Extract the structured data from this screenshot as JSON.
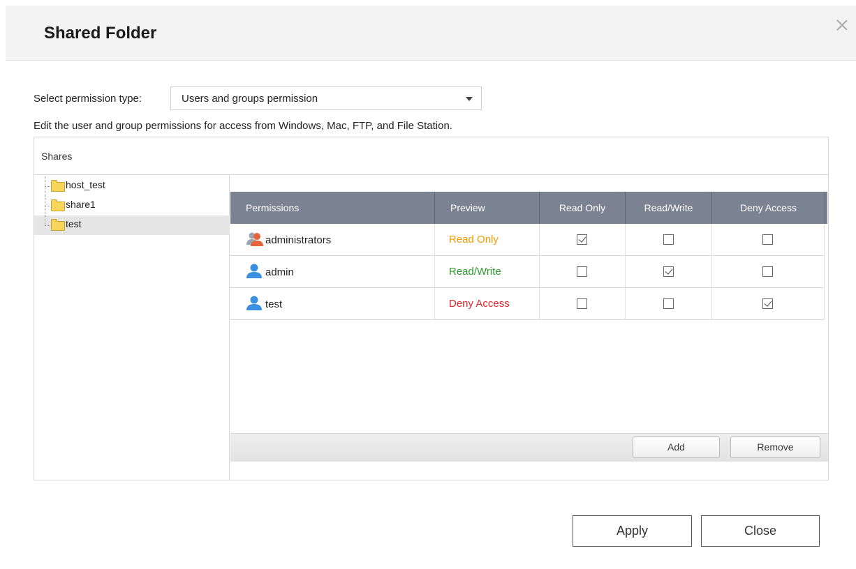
{
  "dialog": {
    "title": "Shared Folder"
  },
  "permission_type": {
    "label": "Select permission type:",
    "selected": "Users and groups permission"
  },
  "description": "Edit the user and group permissions for access from Windows, Mac, FTP, and File Station.",
  "panel": {
    "header": "Shares"
  },
  "tree": {
    "items": [
      {
        "label": "host_test",
        "selected": false
      },
      {
        "label": "share1",
        "selected": false
      },
      {
        "label": "test",
        "selected": true
      }
    ]
  },
  "table": {
    "columns": [
      "Permissions",
      "Preview",
      "Read Only",
      "Read/Write",
      "Deny Access"
    ],
    "rows": [
      {
        "name": "administrators",
        "type": "group",
        "preview": "Read Only",
        "preview_color": "#f29b00",
        "read_only": true,
        "read_write": false,
        "deny": false
      },
      {
        "name": "admin",
        "type": "user",
        "preview": "Read/Write",
        "preview_color": "#2e9a2e",
        "read_only": false,
        "read_write": true,
        "deny": false
      },
      {
        "name": "test",
        "type": "user",
        "preview": "Deny Access",
        "preview_color": "#e0262b",
        "read_only": false,
        "read_write": false,
        "deny": true
      }
    ]
  },
  "toolbar": {
    "add_label": "Add",
    "remove_label": "Remove"
  },
  "footer": {
    "apply_label": "Apply",
    "close_label": "Close"
  },
  "colors": {
    "table_header": "#7b8291",
    "read_only": "#f29b00",
    "read_write": "#2e9a2e",
    "deny_access": "#e0262b",
    "user_icon": "#3b8fe0",
    "group_icon": "#e8623c"
  }
}
